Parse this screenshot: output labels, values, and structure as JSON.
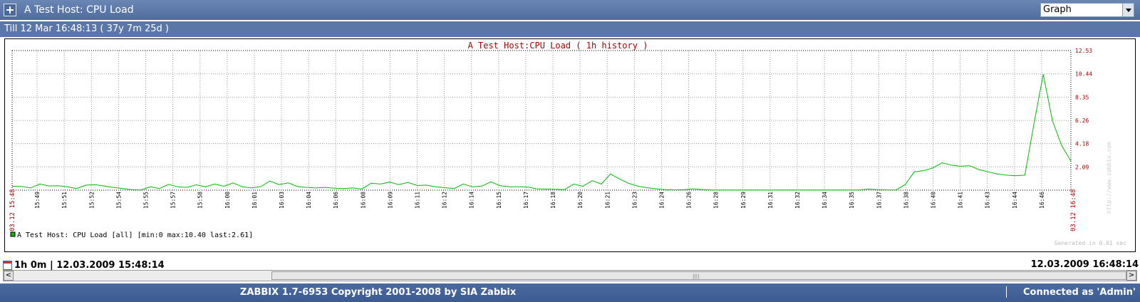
{
  "header": {
    "title": "A Test Host: CPU Load",
    "view_select": "Graph"
  },
  "subheader": {
    "text": "Till 12 Mar 16:48:13 ( 37y 7m 25d )"
  },
  "chart_data": {
    "type": "line",
    "title": "A Test Host:CPU Load ( 1h history )",
    "x_ticks": [
      "15:49",
      "15:51",
      "15:52",
      "15:54",
      "15:55",
      "15:57",
      "15:58",
      "16:00",
      "16:01",
      "16:03",
      "16:04",
      "16:06",
      "16:08",
      "16:09",
      "16:11",
      "16:12",
      "16:14",
      "16:15",
      "16:17",
      "16:18",
      "16:20",
      "16:21",
      "16:23",
      "16:24",
      "16:26",
      "16:28",
      "16:29",
      "16:31",
      "16:32",
      "16:34",
      "16:35",
      "16:37",
      "16:38",
      "16:40",
      "16:41",
      "16:43",
      "16:44",
      "16:46"
    ],
    "x_start_label": "03.12 15:48",
    "x_end_label": "03.12 16:48",
    "y_ticks": [
      "2.09",
      "4.18",
      "6.26",
      "8.35",
      "10.44",
      "12.53"
    ],
    "ylim": [
      0,
      12.53
    ],
    "grid": true,
    "legend": "A Test Host: CPU Load [all] [min:0 max:10.40 last:2.61]",
    "series": [
      {
        "name": "A Test Host: CPU Load",
        "color": "#00bb00",
        "values": [
          0.35,
          0.33,
          0.2,
          0.55,
          0.38,
          0.4,
          0.3,
          0.15,
          0.45,
          0.5,
          0.38,
          0.25,
          0.15,
          0.05,
          0.02,
          0.3,
          0.15,
          0.52,
          0.3,
          0.25,
          0.48,
          0.3,
          0.55,
          0.35,
          0.65,
          0.3,
          0.2,
          0.32,
          0.82,
          0.5,
          0.65,
          0.32,
          0.25,
          0.2,
          0.25,
          0.18,
          0.15,
          0.2,
          0.1,
          0.62,
          0.55,
          0.72,
          0.5,
          0.7,
          0.42,
          0.45,
          0.3,
          0.22,
          0.15,
          0.55,
          0.3,
          0.35,
          0.75,
          0.4,
          0.3,
          0.3,
          0.28,
          0.12,
          0.1,
          0.08,
          0.05,
          0.55,
          0.35,
          0.85,
          0.55,
          1.45,
          1.0,
          0.6,
          0.35,
          0.22,
          0.12,
          0.05,
          0.02,
          0.05,
          0.12,
          0.05,
          0.02,
          0.02,
          0.02,
          0.02,
          0.02,
          0.02,
          0.02,
          0.02,
          0.02,
          0.02,
          0.02,
          0.02,
          0.02,
          0.02,
          0.02,
          0.02,
          0.02,
          0.1,
          0.05,
          0.02,
          0.02,
          0.5,
          1.65,
          1.75,
          2.0,
          2.45,
          2.25,
          2.15,
          2.2,
          1.85,
          1.65,
          1.45,
          1.35,
          1.3,
          1.35,
          6.0,
          10.4,
          6.2,
          4.0,
          2.61
        ]
      }
    ],
    "watermark": "http://www.zabbix.com",
    "generated_note": "Generated in 0.01 sec"
  },
  "footer": {
    "period": "1h 0m | 12.03.2009 15:48:14",
    "end_time": "12.03.2009 16:48:14",
    "scroll_left": "<",
    "scroll_right": ">"
  },
  "bottombar": {
    "copyright": "ZABBIX 1.7-6953 Copyright 2001-2008 by  SIA Zabbix",
    "connected": "Connected as 'Admin'"
  }
}
